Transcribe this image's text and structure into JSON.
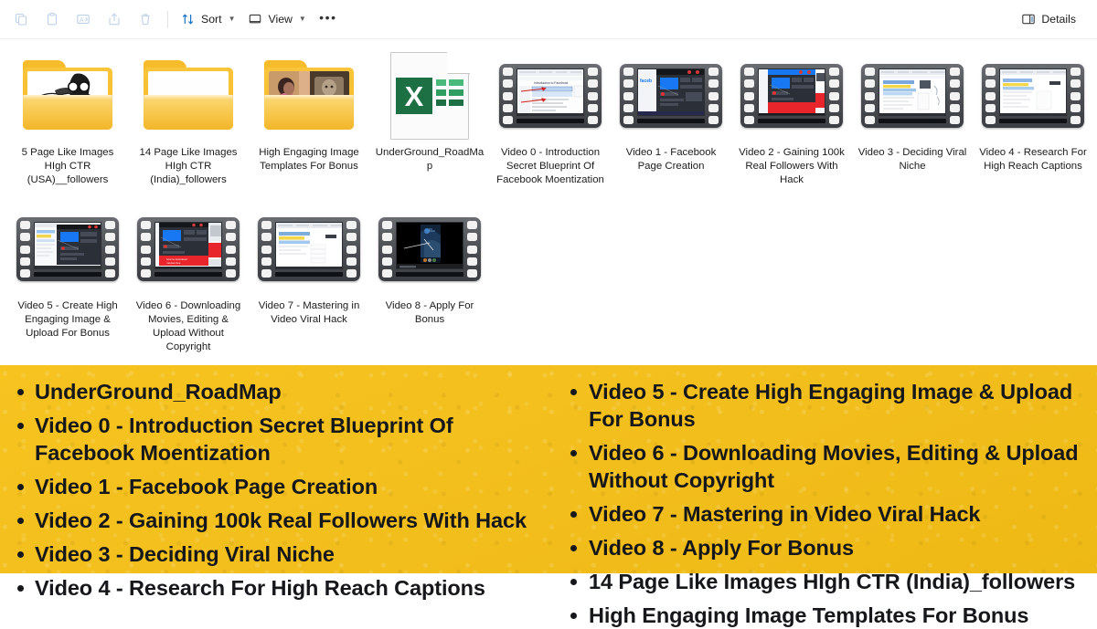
{
  "toolbar": {
    "buttons": [
      {
        "name": "copy",
        "icon": "copy-icon",
        "label": ""
      },
      {
        "name": "paste",
        "icon": "paste-icon",
        "label": ""
      },
      {
        "name": "rename",
        "icon": "rename-icon",
        "label": ""
      },
      {
        "name": "share",
        "icon": "share-icon",
        "label": ""
      },
      {
        "name": "delete",
        "icon": "delete-icon",
        "label": ""
      }
    ],
    "sort_label": "Sort",
    "view_label": "View",
    "overflow_label": "•••",
    "details_label": "Details"
  },
  "files": {
    "row1": [
      {
        "name": "5 Page Like Images HIgh CTR (USA)__followers",
        "type": "folder",
        "thumb": "reading-person-lineart"
      },
      {
        "name": "14 Page Like Images HIgh CTR (India)_followers",
        "type": "folder",
        "thumb": "empty"
      },
      {
        "name": "High Engaging Image Templates For Bonus",
        "type": "folder",
        "thumb": "person-and-statue-photo"
      },
      {
        "name": "UnderGround_RoadMap",
        "type": "excel",
        "glyph": "X"
      },
      {
        "name": "Video 0 - Introduction Secret Blueprint Of Facebook Moentization",
        "type": "video",
        "thumb": "document-with-red-arrows"
      },
      {
        "name": "Video 1 - Facebook Page Creation",
        "type": "video",
        "thumb": "facebook-dark-page"
      },
      {
        "name": "Video 2 - Gaining 100k Real Followers With Hack",
        "type": "video",
        "thumb": "facebook-dark-red-banner"
      },
      {
        "name": "Video 3 - Deciding Viral Niche",
        "type": "video",
        "thumb": "spreadsheet-yellow-blue"
      },
      {
        "name": "Video 4 - Research For High Reach Captions",
        "type": "video",
        "thumb": "spreadsheet-light"
      }
    ],
    "row2": [
      {
        "name": "Video 5 - Create High Engaging Image & Upload For Bonus",
        "type": "video",
        "thumb": "editor-dark-dialog"
      },
      {
        "name": "Video 6 - Downloading Movies, Editing & Upload Without Copyright",
        "type": "video",
        "thumb": "dark-page-red-footer"
      },
      {
        "name": "Video 7 - Mastering in Video Viral Hack",
        "type": "video",
        "thumb": "spreadsheet-blue-rows"
      },
      {
        "name": "Video 8 - Apply For Bonus",
        "type": "video",
        "thumb": "black-phone-video"
      }
    ]
  },
  "banner": {
    "background_color": "#f3bf1d",
    "text_color": "#15171a",
    "left_items": [
      "UnderGround_RoadMap",
      "Video 0 - Introduction Secret Blueprint Of Facebook Moentization",
      "Video 1 - Facebook Page Creation",
      "Video 2 - Gaining 100k Real Followers With Hack",
      "Video 3 - Deciding Viral Niche",
      "Video 4 - Research For High Reach Captions"
    ],
    "right_items": [
      "Video 5 - Create High Engaging Image & Upload For Bonus",
      "Video 6 - Downloading Movies, Editing & Upload Without Copyright",
      "Video 7 - Mastering in Video Viral Hack",
      "Video 8 - Apply For Bonus",
      "14 Page Like Images HIgh CTR (India)_followers",
      "High Engaging Image Templates For Bonus"
    ]
  }
}
